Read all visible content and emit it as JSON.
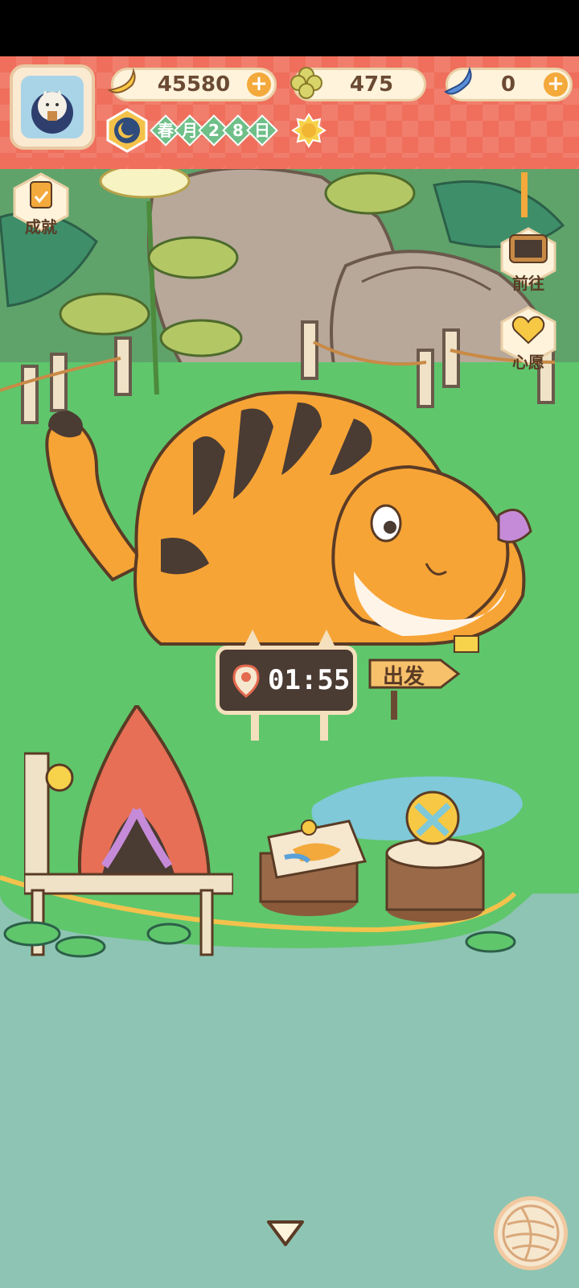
{
  "header": {
    "bananas": "45580",
    "clovers": "475",
    "gems": "0",
    "date": {
      "season": "春",
      "month_label": "月",
      "day_digit_1": "2",
      "day_digit_2": "8",
      "day_label": "日"
    }
  },
  "side_menu": {
    "achievements_label": "成就",
    "travel_label": "前往",
    "wish_label": "心愿"
  },
  "scene": {
    "timer": "01:55",
    "depart_label": "出发"
  },
  "colors": {
    "header_red": "#ef6f5c",
    "grass": "#5fc66c",
    "water": "#8ec4b3",
    "tiger_orange": "#f7a436"
  },
  "icons": {
    "avatar": "tiger-avatar",
    "banana": "banana-icon",
    "clover": "clover-icon",
    "gem": "blue-gem-icon",
    "weather": "sun-icon",
    "location": "map-pin-icon"
  }
}
